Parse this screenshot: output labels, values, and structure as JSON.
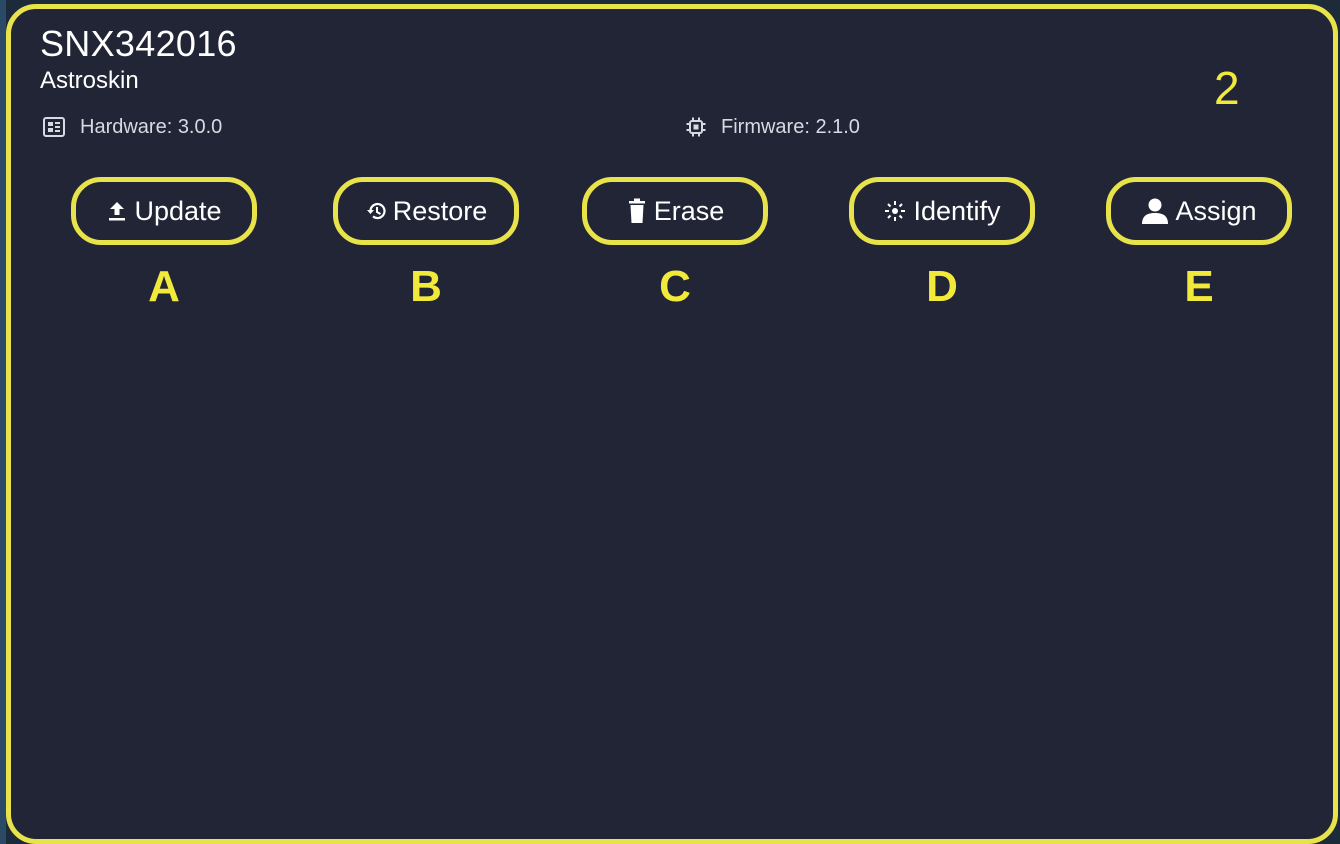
{
  "device": {
    "serial": "SNX342016",
    "model": "Astroskin",
    "hardware": "Hardware: 3.0.0",
    "firmware": "Firmware: 2.1.0"
  },
  "annotation": {
    "number": "2"
  },
  "actions": [
    {
      "label": "Update",
      "icon": "upload-icon",
      "marker": "A"
    },
    {
      "label": "Restore",
      "icon": "history-icon",
      "marker": "B"
    },
    {
      "label": "Erase",
      "icon": "trash-icon",
      "marker": "C"
    },
    {
      "label": "Identify",
      "icon": "sparkle-icon",
      "marker": "D"
    },
    {
      "label": "Assign",
      "icon": "person-icon",
      "marker": "E"
    }
  ],
  "colors": {
    "card_background": "#212535",
    "highlight": "#e8e34a",
    "marker_text": "#f2ea3a",
    "text": "#ffffff"
  }
}
